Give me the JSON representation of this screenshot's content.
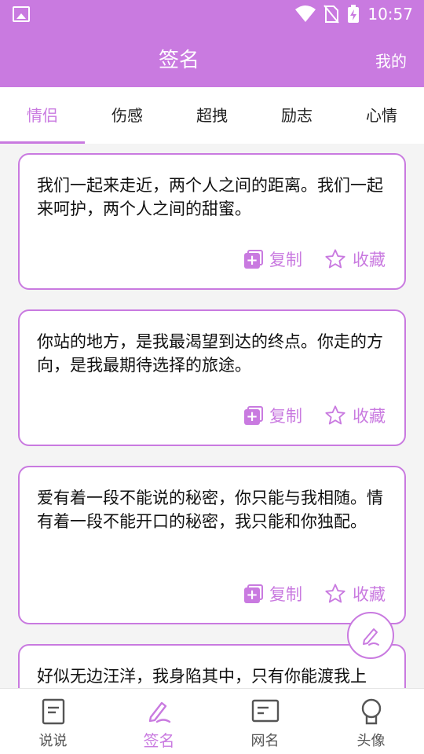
{
  "status": {
    "time": "10:57"
  },
  "appbar": {
    "title": "签名",
    "mine": "我的"
  },
  "tabs": [
    {
      "label": "情侣",
      "active": true
    },
    {
      "label": "伤感"
    },
    {
      "label": "超拽"
    },
    {
      "label": "励志"
    },
    {
      "label": "心情"
    }
  ],
  "cards": [
    {
      "text": "我们一起来走近，两个人之间的距离。我们一起来呵护，两个人之间的甜蜜。"
    },
    {
      "text": "你站的地方，是我最渴望到达的终点。你走的方向，是我最期待选择的旅途。"
    },
    {
      "text": "爱有着一段不能说的秘密，你只能与我相随。情有着一段不能开口的秘密，我只能和你独配。"
    },
    {
      "text": "好似无边汪洋，我身陷其中，只有你能渡我上岸。"
    }
  ],
  "actions": {
    "copy": "复制",
    "favorite": "收藏"
  },
  "bottomnav": [
    {
      "label": "说说"
    },
    {
      "label": "签名",
      "active": true
    },
    {
      "label": "网名"
    },
    {
      "label": "头像"
    }
  ],
  "colors": {
    "accent": "#c97ae0"
  }
}
